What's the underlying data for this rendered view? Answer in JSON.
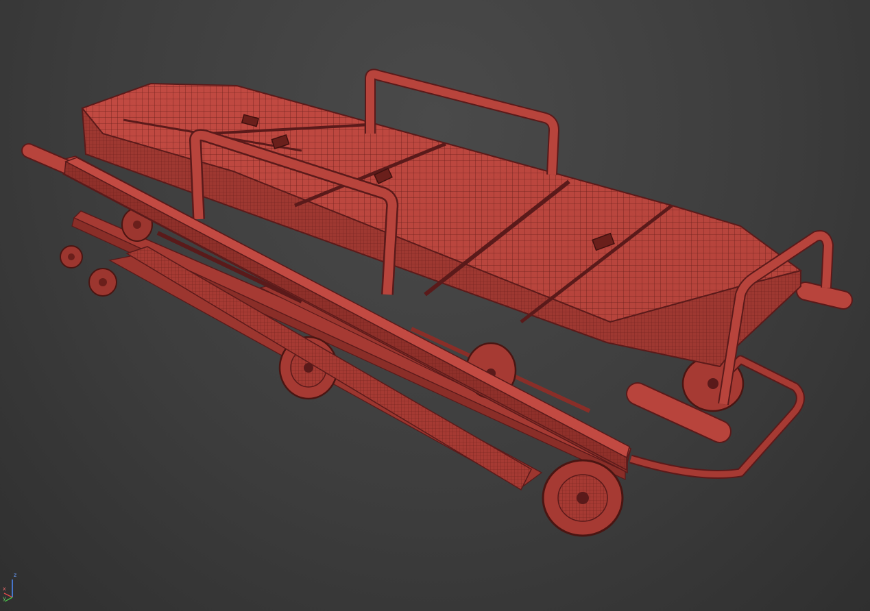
{
  "viewport": {
    "background_color": "#3d3d3d",
    "wire_color": "#5a1a1a",
    "surface_color": "#b8443c",
    "surface_shade_color": "#8a2e28",
    "surface_highlight_color": "#c9534a",
    "object": "stretcher-gurney-wireframe-mesh"
  },
  "gizmo": {
    "z_label": "z",
    "x_label": "x",
    "y_label": "y",
    "z_color": "#4f8cff",
    "x_color": "#e04a4a",
    "y_color": "#49c049"
  }
}
